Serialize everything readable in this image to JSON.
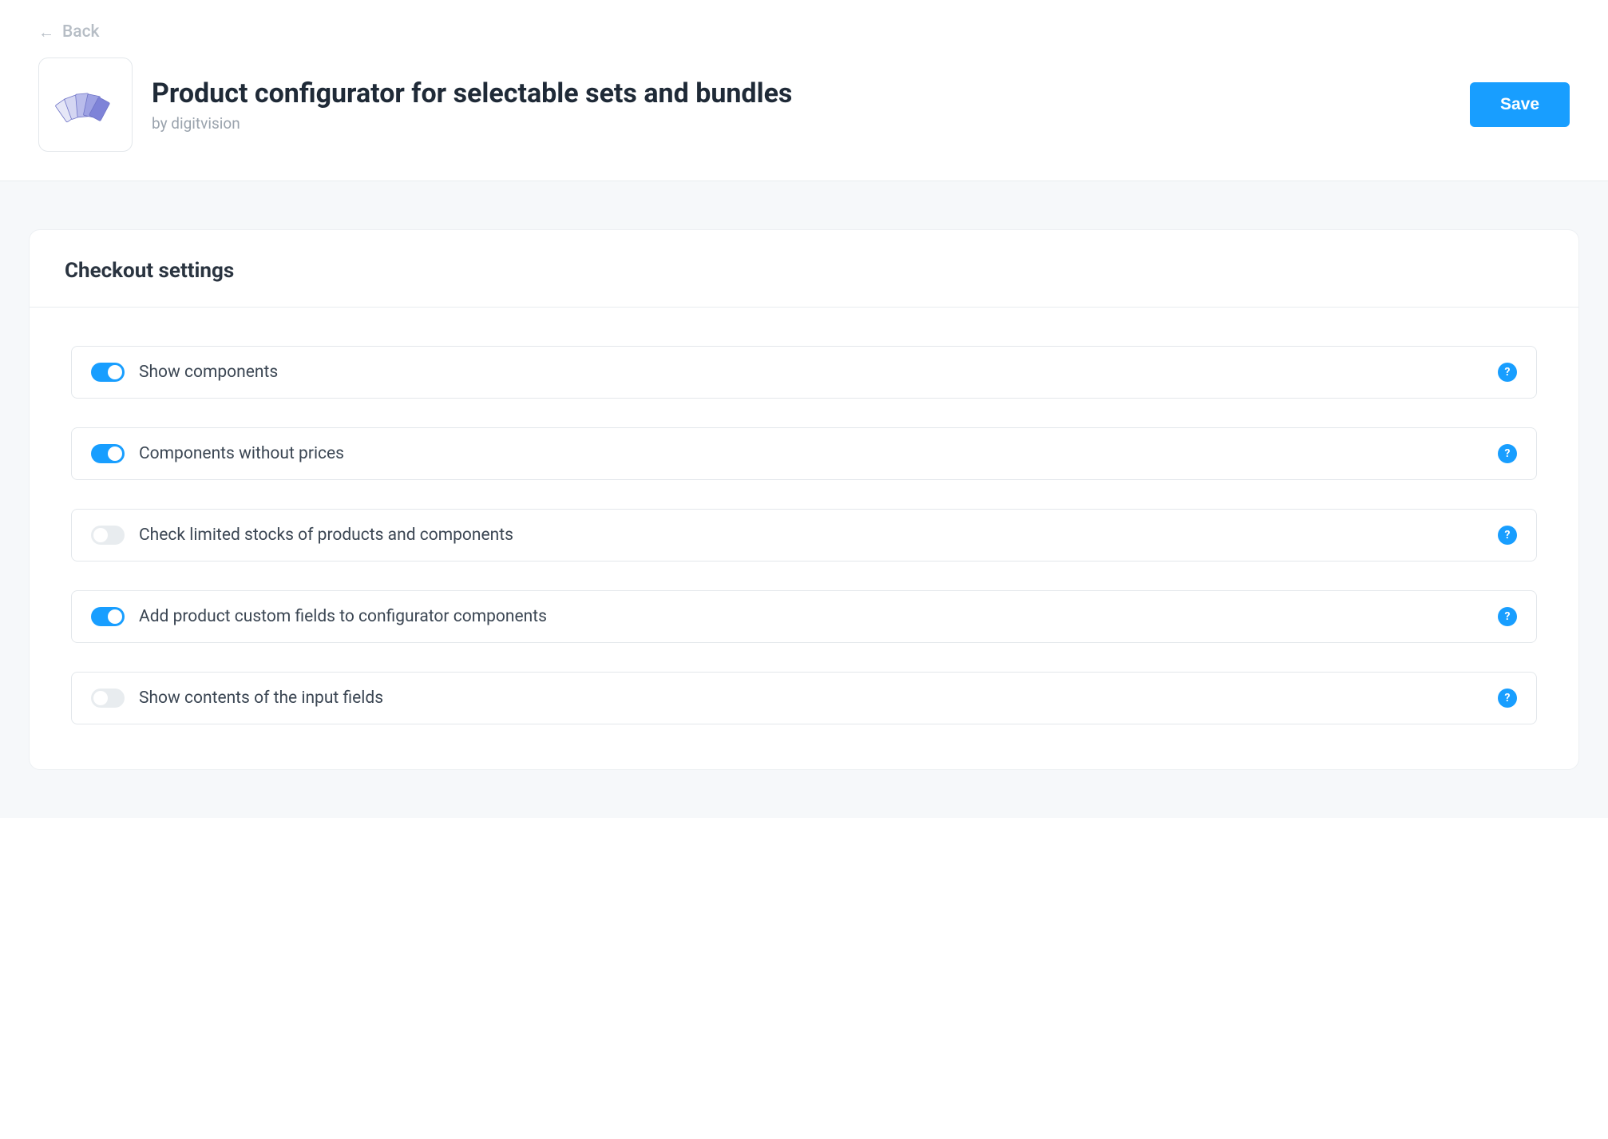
{
  "nav": {
    "back_label": "Back"
  },
  "header": {
    "title": "Product configurator for selectable sets and bundles",
    "vendor_prefix": "by ",
    "vendor_name": "digitvision",
    "save_label": "Save"
  },
  "card": {
    "title": "Checkout settings"
  },
  "settings": [
    {
      "label": "Show components",
      "enabled": true
    },
    {
      "label": "Components without prices",
      "enabled": true
    },
    {
      "label": "Check limited stocks of products and components",
      "enabled": false
    },
    {
      "label": "Add product custom fields to configurator components",
      "enabled": true
    },
    {
      "label": "Show contents of the input fields",
      "enabled": false
    }
  ],
  "help_glyph": "?"
}
